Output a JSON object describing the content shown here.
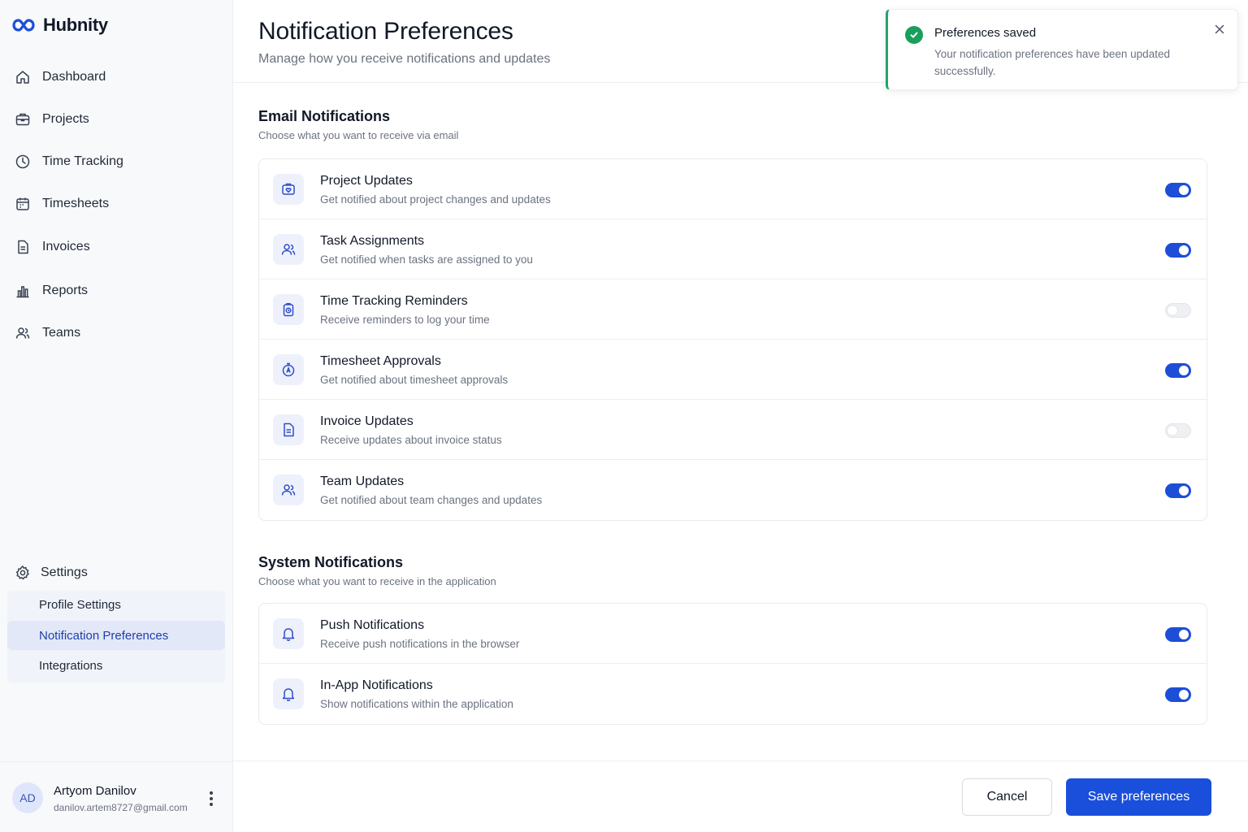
{
  "app": {
    "name": "Hubnity"
  },
  "sidebar": {
    "items": [
      {
        "label": "Dashboard",
        "icon": "home-icon"
      },
      {
        "label": "Projects",
        "icon": "briefcase-icon"
      },
      {
        "label": "Time Tracking",
        "icon": "clock-icon"
      },
      {
        "label": "Timesheets",
        "icon": "calendar-icon"
      },
      {
        "label": "Invoices",
        "icon": "document-icon"
      },
      {
        "label": "Reports",
        "icon": "bar-chart-icon"
      },
      {
        "label": "Teams",
        "icon": "users-icon"
      }
    ],
    "settings": {
      "label": "Settings",
      "icon": "gear-icon",
      "sub_items": [
        {
          "label": "Profile Settings",
          "active": false
        },
        {
          "label": "Notification Preferences",
          "active": true
        },
        {
          "label": "Integrations",
          "active": false
        }
      ]
    },
    "user": {
      "initials": "AD",
      "name": "Artyom Danilov",
      "email": "danilov.artem8727@gmail.com"
    }
  },
  "header": {
    "title": "Notification Preferences",
    "subtitle": "Manage how you receive notifications and updates"
  },
  "email_section": {
    "title": "Email Notifications",
    "subtitle": "Choose what you want to receive via email",
    "items": [
      {
        "title": "Project Updates",
        "desc": "Get notified about project changes and updates",
        "enabled": true,
        "icon": "briefcase-heart-icon"
      },
      {
        "title": "Task Assignments",
        "desc": "Get notified when tasks are assigned to you",
        "enabled": true,
        "icon": "users-icon"
      },
      {
        "title": "Time Tracking Reminders",
        "desc": "Receive reminders to log your time",
        "enabled": false,
        "icon": "clipboard-clock-icon"
      },
      {
        "title": "Timesheet Approvals",
        "desc": "Get notified about timesheet approvals",
        "enabled": true,
        "icon": "timer-icon"
      },
      {
        "title": "Invoice Updates",
        "desc": "Receive updates about invoice status",
        "enabled": false,
        "icon": "document-icon"
      },
      {
        "title": "Team Updates",
        "desc": "Get notified about team changes and updates",
        "enabled": true,
        "icon": "users-icon"
      }
    ]
  },
  "system_section": {
    "title": "System Notifications",
    "subtitle": "Choose what you want to receive in the application",
    "items": [
      {
        "title": "Push Notifications",
        "desc": "Receive push notifications in the browser",
        "enabled": true,
        "icon": "bell-icon"
      },
      {
        "title": "In-App Notifications",
        "desc": "Show notifications within the application",
        "enabled": true,
        "icon": "bell-icon"
      }
    ]
  },
  "footer": {
    "cancel_label": "Cancel",
    "save_label": "Save preferences"
  },
  "toast": {
    "title": "Preferences saved",
    "message": "Your notification preferences have been updated successfully."
  },
  "colors": {
    "accent": "#1a4fdc",
    "success": "#1a9e5c",
    "active_nav_bg": "#e3e8f8"
  }
}
